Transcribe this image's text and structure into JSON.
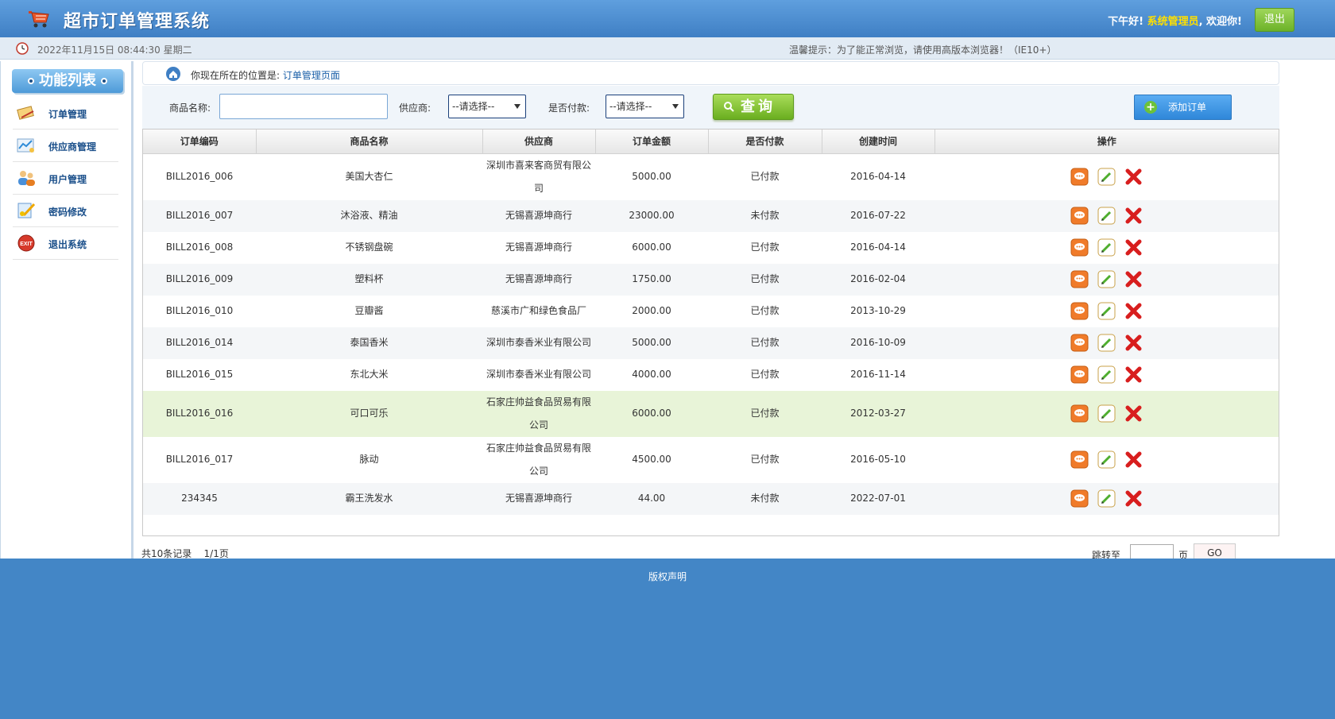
{
  "header": {
    "app_title": "超市订单管理系统",
    "greeting_prefix": "下午好!",
    "user_name": "系统管理员",
    "greeting_suffix": ", 欢迎你!",
    "logout_label": "退出"
  },
  "subbar": {
    "datetime": "2022年11月15日 08:44:30 星期二",
    "tip": "温馨提示：为了能正常浏览，请使用高版本浏览器！（IE10+）"
  },
  "sidebar": {
    "title": "功能列表",
    "items": [
      {
        "label": "订单管理",
        "icon": "order-icon"
      },
      {
        "label": "供应商管理",
        "icon": "provider-icon"
      },
      {
        "label": "用户管理",
        "icon": "users-icon"
      },
      {
        "label": "密码修改",
        "icon": "password-icon"
      },
      {
        "label": "退出系统",
        "icon": "exit-icon"
      }
    ]
  },
  "breadcrumb": {
    "prefix": "你现在所在的位置是:",
    "current": "订单管理页面"
  },
  "search": {
    "product_label": "商品名称:",
    "product_value": "",
    "provider_label": "供应商:",
    "provider_selected": "--请选择--",
    "paid_label": "是否付款:",
    "paid_selected": "--请选择--",
    "query_label": "查询",
    "add_label": "添加订单"
  },
  "table": {
    "headers": [
      "订单编码",
      "商品名称",
      "供应商",
      "订单金额",
      "是否付款",
      "创建时间",
      "操作"
    ],
    "rows": [
      {
        "code": "BILL2016_006",
        "product": "美国大杏仁",
        "provider_1": "深圳市喜来客商贸有限公",
        "provider_2": "司",
        "amount": "5000.00",
        "paid": "已付款",
        "date": "2016-04-14"
      },
      {
        "code": "BILL2016_007",
        "product": "沐浴液、精油",
        "provider_1": "无锡喜源坤商行",
        "provider_2": "",
        "amount": "23000.00",
        "paid": "未付款",
        "date": "2016-07-22"
      },
      {
        "code": "BILL2016_008",
        "product": "不锈钢盘碗",
        "provider_1": "无锡喜源坤商行",
        "provider_2": "",
        "amount": "6000.00",
        "paid": "已付款",
        "date": "2016-04-14"
      },
      {
        "code": "BILL2016_009",
        "product": "塑料杯",
        "provider_1": "无锡喜源坤商行",
        "provider_2": "",
        "amount": "1750.00",
        "paid": "已付款",
        "date": "2016-02-04"
      },
      {
        "code": "BILL2016_010",
        "product": "豆瓣酱",
        "provider_1": "慈溪市广和绿色食品厂",
        "provider_2": "",
        "amount": "2000.00",
        "paid": "已付款",
        "date": "2013-10-29"
      },
      {
        "code": "BILL2016_014",
        "product": "泰国香米",
        "provider_1": "深圳市泰香米业有限公司",
        "provider_2": "",
        "amount": "5000.00",
        "paid": "已付款",
        "date": "2016-10-09"
      },
      {
        "code": "BILL2016_015",
        "product": "东北大米",
        "provider_1": "深圳市泰香米业有限公司",
        "provider_2": "",
        "amount": "4000.00",
        "paid": "已付款",
        "date": "2016-11-14"
      },
      {
        "code": "BILL2016_016",
        "product": "可口可乐",
        "provider_1": "石家庄帅益食品贸易有限",
        "provider_2": "公司",
        "amount": "6000.00",
        "paid": "已付款",
        "date": "2012-03-27"
      },
      {
        "code": "BILL2016_017",
        "product": "脉动",
        "provider_1": "石家庄帅益食品贸易有限",
        "provider_2": "公司",
        "amount": "4500.00",
        "paid": "已付款",
        "date": "2016-05-10"
      },
      {
        "code": "234345",
        "product": "霸王洗发水",
        "provider_1": "无锡喜源坤商行",
        "provider_2": "",
        "amount": "44.00",
        "paid": "未付款",
        "date": "2022-07-01"
      }
    ],
    "highlighted_row": 7,
    "op_icons": [
      "view-icon",
      "edit-icon",
      "delete-icon"
    ]
  },
  "pager": {
    "record_count": "共10条记录",
    "page_info": "1/1页",
    "jump_label": "跳转至",
    "page_value": "",
    "page_unit": "页",
    "go_label": "GO"
  },
  "footer": {
    "copyright": "版权声明"
  },
  "colors": {
    "header_blue": "#3f7fc4",
    "footer_blue": "#4386c6",
    "green_button": "#6aae1f",
    "highlight_row": "#e8f4d8",
    "user_name_yellow": "#ffe000"
  }
}
